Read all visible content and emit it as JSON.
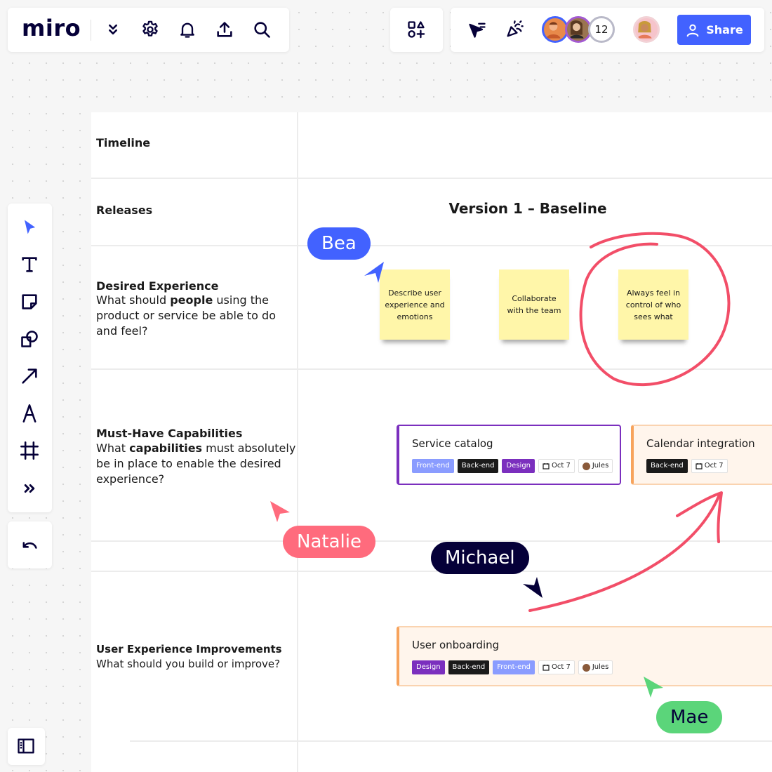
{
  "header": {
    "logo_text": "miro",
    "icons": [
      "chevron-double-down-icon",
      "gear-icon",
      "bell-icon",
      "upload-icon",
      "search-icon"
    ]
  },
  "apps": {
    "icon": "shapes-plus-icon"
  },
  "collab": {
    "participant_count": "12",
    "share_label": "Share",
    "accent_color": "#4262ff"
  },
  "toolbar": {
    "tools": [
      "select-pointer-icon",
      "text-icon",
      "sticky-note-icon",
      "shapes-icon",
      "arrow-line-icon",
      "pen-icon",
      "frame-icon",
      "more-tools-icon"
    ],
    "undo_icon": "undo-icon",
    "panel_icon": "sidebar-panel-icon"
  },
  "board": {
    "rows": [
      {
        "title": "Timeline"
      },
      {
        "title": "Releases"
      },
      {
        "title": "Desired Experience",
        "desc_parts": [
          "What should ",
          "people",
          " using the product or service be able to do and feel?"
        ]
      },
      {
        "title": "Must-Have Capabilities",
        "desc_parts": [
          "What ",
          "capabilities",
          " must absolutely be in place to enable the desired experience?"
        ]
      },
      {
        "title": "User Experience Improvements",
        "desc": "What should you build or improve?"
      }
    ],
    "release_title": "Version 1 – Baseline",
    "stickies": [
      {
        "text": "Describe user experience and emotions"
      },
      {
        "text": "Collaborate with the team"
      },
      {
        "text": "Always feel in control of who sees what"
      }
    ],
    "cards": [
      {
        "title": "Service catalog",
        "border_color": "#7b2fbe",
        "tags": [
          {
            "label": "Front-end",
            "color": "#8a9cff"
          },
          {
            "label": "Back-end",
            "color": "#1a1a1a"
          },
          {
            "label": "Design",
            "color": "#7b2fbe"
          }
        ],
        "date": "Oct 7",
        "assignee": "Jules"
      },
      {
        "title": "Calendar integration",
        "border_color": "#f7a35c",
        "tags": [
          {
            "label": "Back-end",
            "color": "#1a1a1a"
          }
        ],
        "date": "Oct 7"
      },
      {
        "title": "User onboarding",
        "border_color": "#f7a35c",
        "tags": [
          {
            "label": "Design",
            "color": "#7b2fbe"
          },
          {
            "label": "Back-end",
            "color": "#1a1a1a"
          },
          {
            "label": "Front-end",
            "color": "#8a9cff"
          }
        ],
        "date": "Oct 7",
        "assignee": "Jules"
      }
    ]
  },
  "cursors": [
    {
      "name": "Bea",
      "color": "#4262ff"
    },
    {
      "name": "Natalie",
      "color": "#ff6b7d"
    },
    {
      "name": "Michael",
      "color": "#050038"
    },
    {
      "name": "Mae",
      "color": "#5bd57a"
    }
  ],
  "annotation_color": "#f24e68"
}
